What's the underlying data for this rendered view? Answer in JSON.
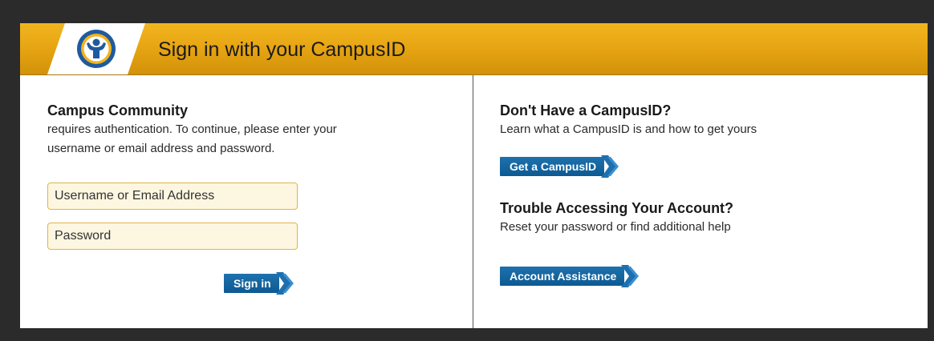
{
  "header": {
    "title": "Sign in with your CampusID"
  },
  "login": {
    "heading": "Campus Community",
    "description": "requires authentication. To continue, please enter your username or email address and password.",
    "username_placeholder": "Username or Email Address",
    "password_placeholder": "Password",
    "signin_label": "Sign in"
  },
  "no_account": {
    "heading": "Don't Have a CampusID?",
    "description": "Learn what a CampusID is and how to get yours",
    "button_label": "Get a CampusID"
  },
  "trouble": {
    "heading": "Trouble Accessing Your Account?",
    "description": "Reset your password or find additional help",
    "button_label": "Account Assistance"
  },
  "colors": {
    "banner": "#e6a412",
    "button": "#0d5a92",
    "field_bg": "#fdf6e1",
    "field_border": "#e0b545"
  },
  "icons": {
    "logo": "campus-person-logo-icon",
    "button_arrow": "double-chevron-right-icon"
  }
}
